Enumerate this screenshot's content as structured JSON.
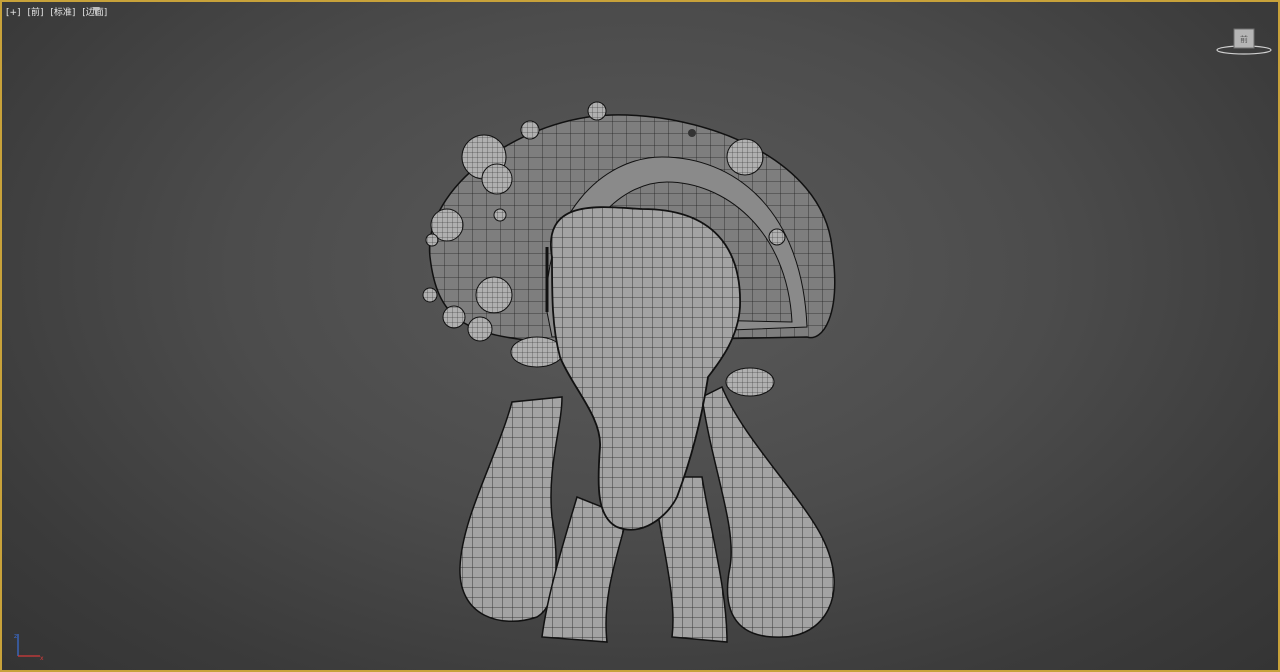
{
  "viewport": {
    "labels": [
      {
        "text": "[+]"
      },
      {
        "text": "[前]"
      },
      {
        "text": "[标准]"
      },
      {
        "text": "[边面]"
      }
    ],
    "viewcube_face": "前",
    "active_border_color": "#c8a23a",
    "model": "mushroom-creature-wireframe"
  },
  "colors": {
    "background_top": "#5a5a5a",
    "background_bottom": "#343434",
    "mesh_fill": "#9a9a9a",
    "mesh_wire": "#1a1a1a"
  }
}
